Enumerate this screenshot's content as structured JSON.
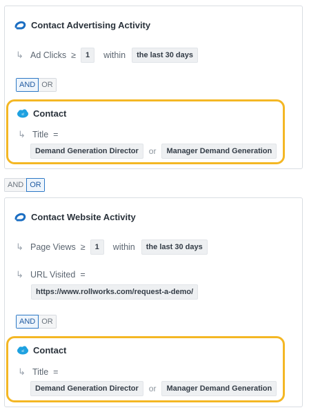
{
  "colors": {
    "highlight": "#f4b724",
    "active_toggle": "#2b77c5",
    "salesforce": "#1ea1e0",
    "rollworks": "#1b6ec2"
  },
  "group1": {
    "title": "Contact Advertising Activity",
    "condition": {
      "field": "Ad Clicks",
      "operator": "≥",
      "value": "1",
      "within_label": "within",
      "timeframe": "the last 30 days"
    },
    "toggle": {
      "and": "AND",
      "or": "OR",
      "selected": "AND"
    },
    "contact": {
      "title": "Contact",
      "field": "Title",
      "operator": "=",
      "values": [
        "Demand Generation Director",
        "Manager Demand Generation"
      ],
      "or_label": "or"
    }
  },
  "group_toggle": {
    "and": "AND",
    "or": "OR",
    "selected": "OR"
  },
  "group2": {
    "title": "Contact Website Activity",
    "condition": {
      "field": "Page Views",
      "operator": "≥",
      "value": "1",
      "within_label": "within",
      "timeframe": "the last 30 days"
    },
    "url_condition": {
      "field": "URL Visited",
      "operator": "=",
      "value": "https://www.rollworks.com/request-a-demo/"
    },
    "toggle": {
      "and": "AND",
      "or": "OR",
      "selected": "AND"
    },
    "contact": {
      "title": "Contact",
      "field": "Title",
      "operator": "=",
      "values": [
        "Demand Generation Director",
        "Manager Demand Generation"
      ],
      "or_label": "or"
    }
  },
  "icons": {
    "rollworks": "rollworks-logo-icon",
    "salesforce": "salesforce-cloud-icon",
    "branch": "branch-arrow-icon"
  }
}
